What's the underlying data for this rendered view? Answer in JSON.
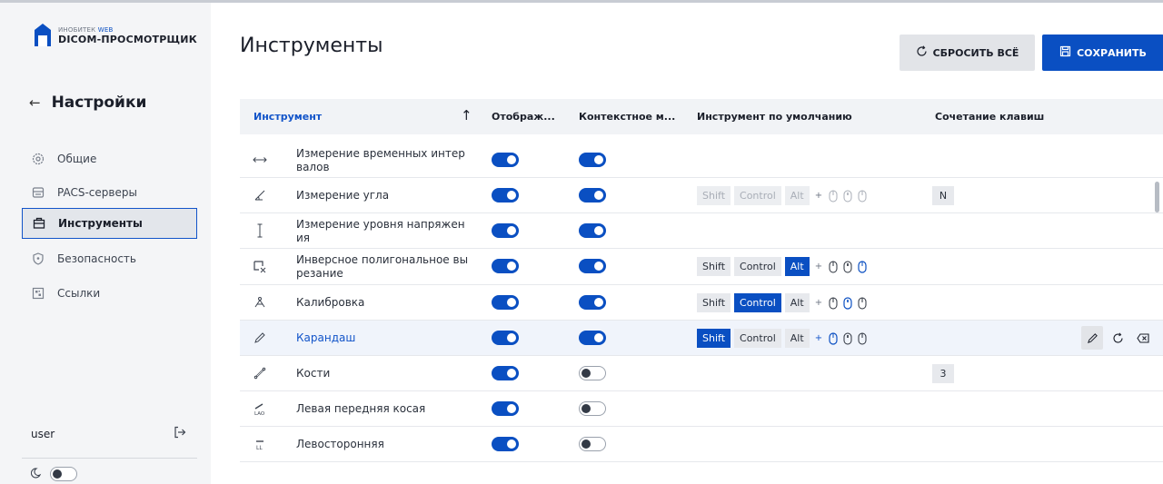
{
  "app": {
    "logo_top_prefix": "ИНОБИТЕК",
    "logo_top_accent": "WEB",
    "logo_main": "DICOM-ПРОСМОТРЩИК"
  },
  "sidebar": {
    "back_title": "Настройки",
    "items": [
      {
        "label": "Общие",
        "icon": "gear-icon"
      },
      {
        "label": "PACS-серверы",
        "icon": "server-icon"
      },
      {
        "label": "Инструменты",
        "icon": "briefcase-icon",
        "active": true
      },
      {
        "label": "Безопасность",
        "icon": "shield-icon"
      },
      {
        "label": "Ссылки",
        "icon": "qr-icon"
      }
    ],
    "user": "user",
    "theme_toggle": false
  },
  "page": {
    "title": "Инструменты",
    "reset_label": "СБРОСИТЬ ВСЁ",
    "save_label": "СОХРАНИТЬ"
  },
  "table": {
    "headers": {
      "tool": "Инструмент",
      "display": "Отображ...",
      "context": "Контекстное м...",
      "default": "Инструмент по умолчанию",
      "shortcut": "Сочетание клавиш"
    },
    "modifier_labels": {
      "shift": "Shift",
      "control": "Control",
      "alt": "Alt"
    },
    "rows": [
      {
        "icon": "time-interval-icon",
        "name": "Измерение временных интер валов",
        "display": true,
        "context": true,
        "modifiers": null,
        "shortcut": ""
      },
      {
        "icon": "angle-icon",
        "name": "Измерение угла",
        "display": true,
        "context": true,
        "modifiers": {
          "state": "disabled",
          "shift": false,
          "control": false,
          "alt": false,
          "mouse": ""
        },
        "shortcut": "N"
      },
      {
        "icon": "voltage-level-icon",
        "name": "Измерение уровня напряжен ия",
        "display": true,
        "context": true,
        "modifiers": null,
        "shortcut": ""
      },
      {
        "icon": "polygon-cut-icon",
        "name": "Инверсное полигональное вы резание",
        "display": true,
        "context": true,
        "modifiers": {
          "state": "enabled",
          "shift": false,
          "control": false,
          "alt": true,
          "mouse": "right"
        },
        "shortcut": ""
      },
      {
        "icon": "calibration-icon",
        "name": "Калибровка",
        "display": true,
        "context": true,
        "modifiers": {
          "state": "enabled",
          "shift": false,
          "control": true,
          "alt": false,
          "mouse": "middle"
        },
        "shortcut": ""
      },
      {
        "icon": "pencil-icon",
        "name": "Карандаш",
        "display": true,
        "context": true,
        "modifiers": {
          "state": "enabled",
          "shift": true,
          "control": false,
          "alt": false,
          "mouse": "left"
        },
        "shortcut": "",
        "selected": true
      },
      {
        "icon": "bones-icon",
        "name": "Кости",
        "display": true,
        "context": false,
        "modifiers": null,
        "shortcut": "3"
      },
      {
        "icon": "lao-icon",
        "name": "Левая передняя косая",
        "display": true,
        "context": false,
        "modifiers": null,
        "shortcut": ""
      },
      {
        "icon": "ll-icon",
        "name": "Левосторонняя",
        "display": true,
        "context": false,
        "modifiers": null,
        "shortcut": ""
      }
    ]
  },
  "colors": {
    "accent": "#0a4fc2",
    "sidebar_bg": "#f4f5f7",
    "header_bg": "#f1f3f6",
    "selected_row": "#f0f4fb"
  }
}
